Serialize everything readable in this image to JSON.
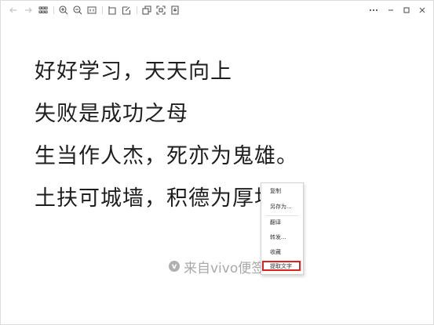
{
  "toolbar": {
    "icons": [
      "back-arrow-icon",
      "forward-arrow-icon",
      "grid-icon",
      "zoom-in-icon",
      "zoom-out-icon",
      "actual-size-icon",
      "rotate-icon",
      "edit-icon",
      "copy-icon",
      "scan-icon",
      "save-icon"
    ],
    "window_controls": [
      "more-icon",
      "minimize-icon",
      "maximize-icon",
      "close-icon"
    ]
  },
  "image": {
    "lines": [
      "好好学习，天天向上",
      "失败是成功之母",
      "生当作人杰，死亦为鬼雄。",
      "土扶可城墙，积德为厚址"
    ],
    "watermark_logo": "v",
    "watermark_text": "来自vivo便签"
  },
  "context_menu": {
    "items": [
      "复制",
      "另存为...",
      "翻译",
      "转发...",
      "收藏",
      "提取文字"
    ],
    "highlighted": "提取文字",
    "highlight_color": "#e0211d"
  }
}
